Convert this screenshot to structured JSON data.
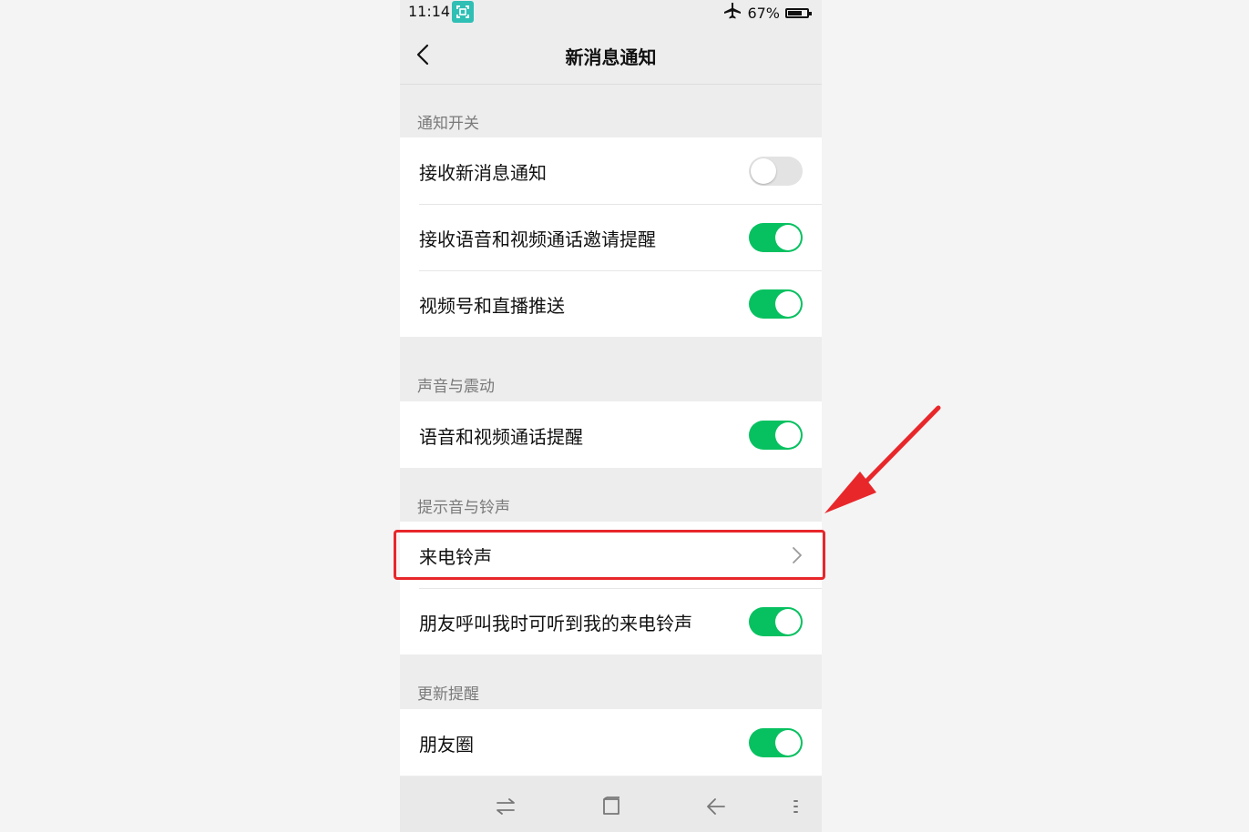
{
  "status_bar": {
    "time": "11:14",
    "battery_text": "67%",
    "battery_level": 0.67,
    "screenshot_icon": "screenshot-icon",
    "airplane_icon": "airplane-icon"
  },
  "nav": {
    "title": "新消息通知",
    "back_icon": "back-chevron-icon"
  },
  "sections": [
    {
      "label": "通知开关",
      "rows": [
        {
          "label": "接收新消息通知",
          "control": "toggle",
          "on": false
        },
        {
          "label": "接收语音和视频通话邀请提醒",
          "control": "toggle",
          "on": true
        },
        {
          "label": "视频号和直播推送",
          "control": "toggle",
          "on": true
        }
      ]
    },
    {
      "label": "声音与震动",
      "rows": [
        {
          "label": "语音和视频通话提醒",
          "control": "toggle",
          "on": true
        }
      ]
    },
    {
      "label": "提示音与铃声",
      "rows": [
        {
          "label": "来电铃声",
          "control": "chevron"
        },
        {
          "label": "朋友呼叫我时可听到我的来电铃声",
          "control": "toggle",
          "on": true
        }
      ]
    },
    {
      "label": "更新提醒",
      "rows": [
        {
          "label": "朋友圈",
          "control": "toggle",
          "on": true
        }
      ]
    }
  ],
  "bottom_bar": [
    "switch-apps-icon",
    "home-square-icon",
    "back-arrow-icon",
    "menu-dots-icon"
  ],
  "colors": {
    "toggle_on": "#07c160",
    "toggle_off": "#e3e3e3",
    "highlight": "#e8272b",
    "background": "#ededed"
  }
}
